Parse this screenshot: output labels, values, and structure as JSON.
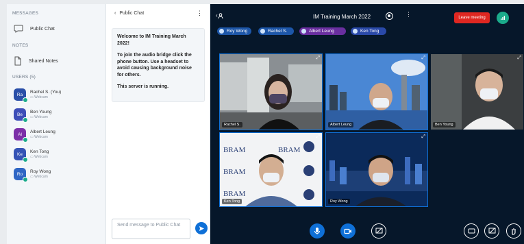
{
  "sidebar": {
    "messages_label": "MESSAGES",
    "public_chat": "Public Chat",
    "notes_label": "NOTES",
    "shared_notes": "Shared Notes",
    "users_label": "USERS (5)",
    "users": [
      {
        "initials": "Ra",
        "name": "Rachel S. (You)",
        "sub": "Webcam",
        "color": "#2a4fa8"
      },
      {
        "initials": "Be",
        "name": "Ben Young",
        "sub": "Webcam",
        "color": "#3d4eb8"
      },
      {
        "initials": "Al",
        "name": "Albert Leung",
        "sub": "Webcam",
        "color": "#7b2fa8"
      },
      {
        "initials": "Ke",
        "name": "Ken Tong",
        "sub": "Webcam",
        "color": "#3553b5"
      },
      {
        "initials": "Ro",
        "name": "Roy Wong",
        "sub": "Webcam",
        "color": "#2f66c4"
      }
    ]
  },
  "chat": {
    "header": "Public Chat",
    "welcome_title": "Welcome to IM Training March 2022!",
    "welcome_p1": "To join the audio bridge click the phone button. Use a headset to avoid causing background noise for others.",
    "welcome_p2": "This server is running.",
    "input_placeholder": "Send message to Public Chat"
  },
  "meeting": {
    "title": "IM Training March 2022",
    "leave_label": "Leave meeting",
    "talkers": [
      "Roy Wong",
      "Rachel S.",
      "Albert Leung",
      "Ken Tong"
    ],
    "tiles": [
      {
        "name": "Rachel S."
      },
      {
        "name": "Albert Leung"
      },
      {
        "name": "Ben Young"
      },
      {
        "name": "Ken Tong"
      },
      {
        "name": "Roy Wong"
      }
    ]
  },
  "colors": {
    "accent": "#0f70d7",
    "danger": "#df2721",
    "success": "#1bab8b",
    "video_bg": "#06172a"
  }
}
